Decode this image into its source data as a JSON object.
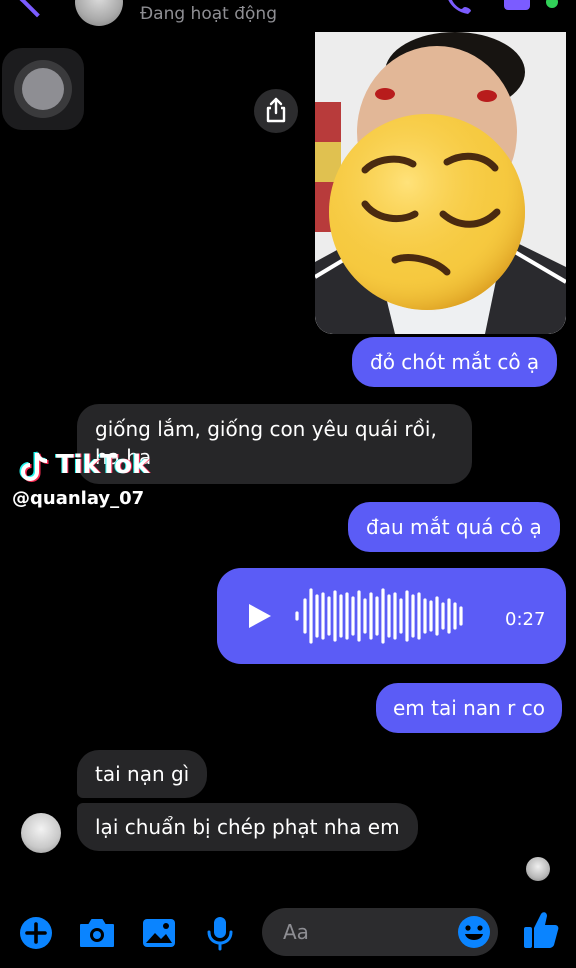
{
  "header": {
    "status": "Đang hoạt động"
  },
  "messages": [
    {
      "id": "m1",
      "direction": "outgoing",
      "text": "đỏ chót mắt cô ạ"
    },
    {
      "id": "m2",
      "direction": "incoming",
      "text": "giống lắm, giống con yêu quái rồi, ha ha"
    },
    {
      "id": "m3",
      "direction": "outgoing",
      "text": "đau mắt quá cô ạ"
    },
    {
      "id": "m4",
      "direction": "outgoing",
      "type": "voice",
      "duration": "0:27"
    },
    {
      "id": "m5",
      "direction": "outgoing",
      "text": "em tai nan r co"
    },
    {
      "id": "m6",
      "direction": "incoming",
      "text": "tai nạn gì"
    },
    {
      "id": "m7",
      "direction": "incoming",
      "text": "lại chuẩn bị chép phạt nha em"
    }
  ],
  "watermark": {
    "brand": "TikTok",
    "handle": "@quanlay_07"
  },
  "composer": {
    "placeholder": "Aa"
  },
  "icons": [
    "back-chevron-icon",
    "phone-icon",
    "video-icon",
    "share-icon",
    "play-icon",
    "plus-icon",
    "camera-icon",
    "image-icon",
    "mic-icon",
    "emoji-icon",
    "thumbs-up-icon"
  ],
  "colors": {
    "background": "#000000",
    "outgoing_bubble": "#5b5cf6",
    "incoming_bubble": "#262628",
    "accent": "#0a84ff",
    "status_text": "#8e8e93"
  }
}
